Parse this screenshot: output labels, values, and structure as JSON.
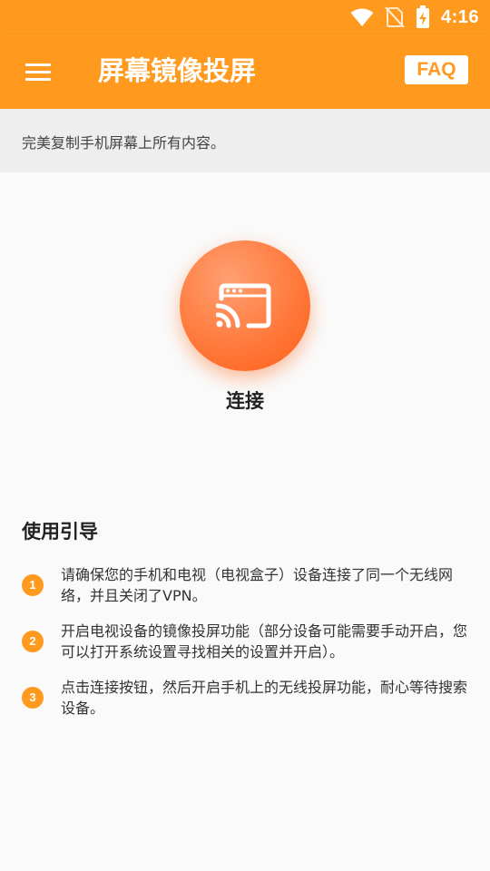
{
  "status_bar": {
    "time": "4:16",
    "icons": [
      "wifi-icon",
      "no-sim-icon",
      "battery-charging-icon"
    ]
  },
  "app_bar": {
    "title": "屏幕镜像投屏",
    "faq_label": "FAQ",
    "menu_icon": "hamburger-menu-icon"
  },
  "subtitle": "完美复制手机屏幕上所有内容。",
  "connect": {
    "label": "连接",
    "icon": "cast-screen-icon"
  },
  "guide": {
    "title": "使用引导",
    "steps": [
      {
        "num": "1",
        "text": "请确保您的手机和电视（电视盒子）设备连接了同一个无线网络，并且关闭了VPN。"
      },
      {
        "num": "2",
        "text": "开启电视设备的镜像投屏功能（部分设备可能需要手动开启，您可以打开系统设置寻找相关的设置并开启）。"
      },
      {
        "num": "3",
        "text": "点击连接按钮，然后开启手机上的无线投屏功能，耐心等待搜索设备。"
      }
    ]
  },
  "colors": {
    "accent": "#ff9a1f",
    "button_gradient_start": "#ff9f72",
    "button_gradient_end": "#ff5e16",
    "background": "#fafafa",
    "subtitle_bg": "#eeeeee"
  }
}
